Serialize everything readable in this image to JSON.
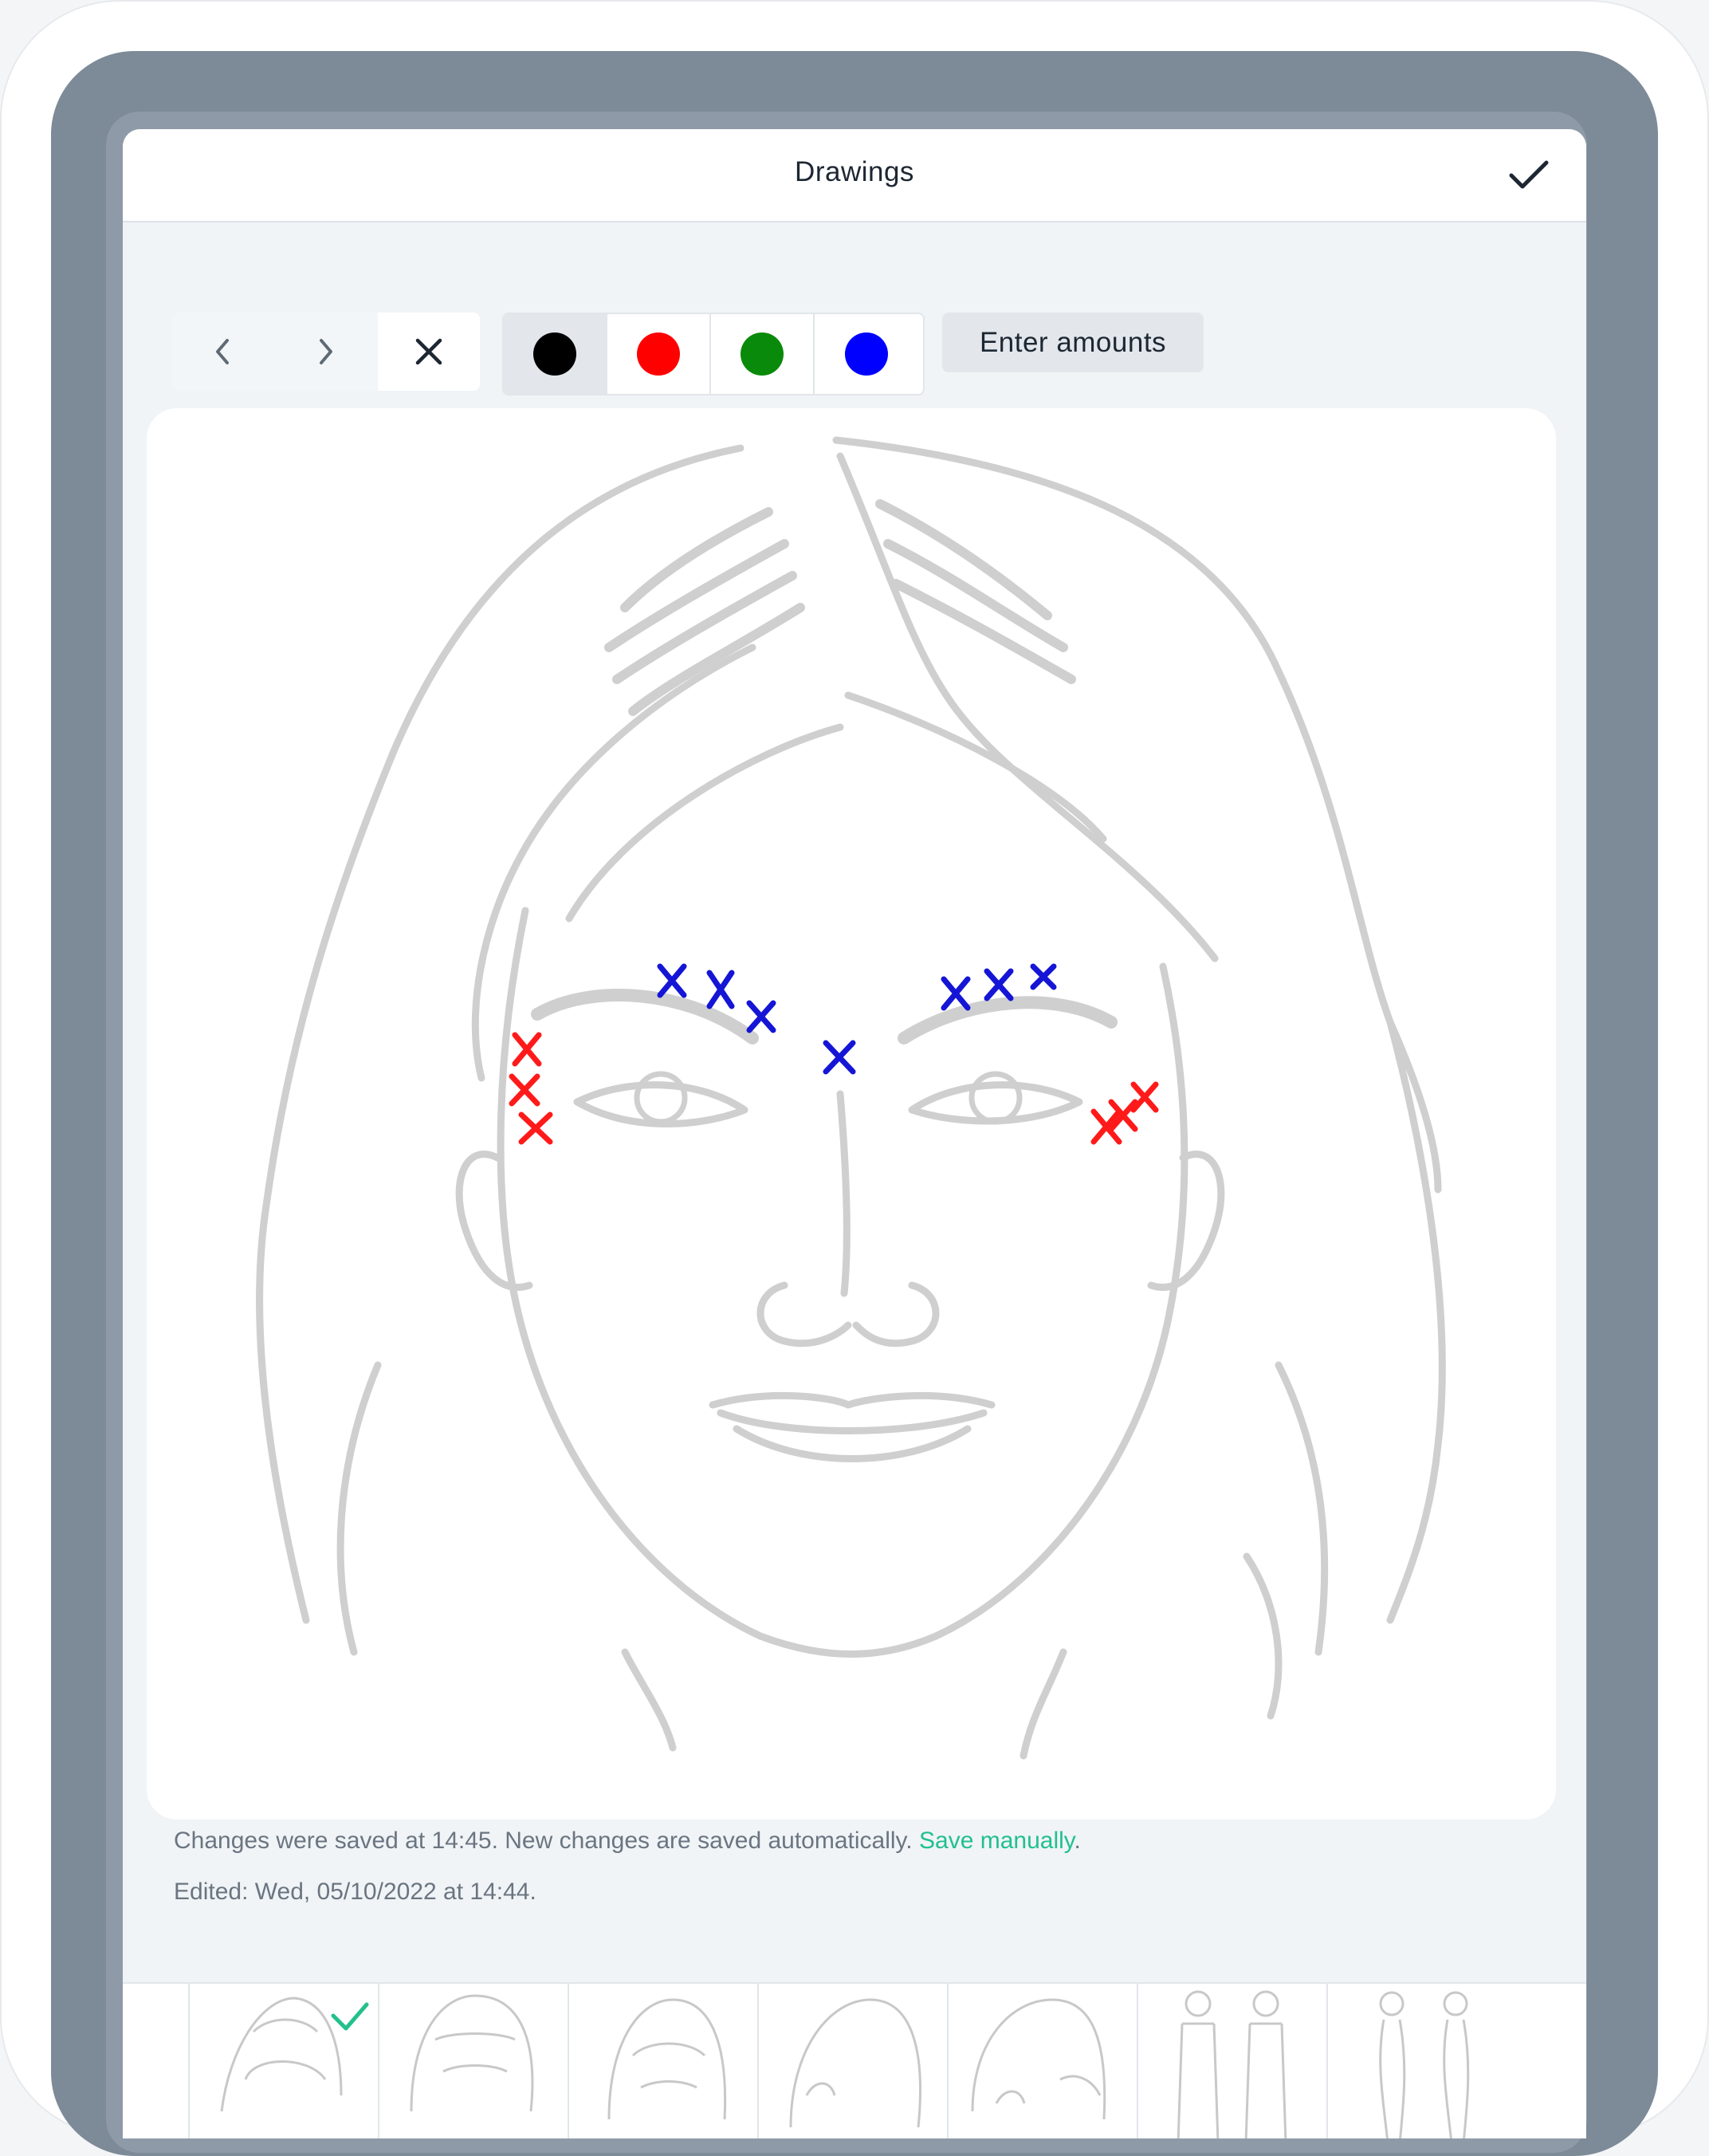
{
  "header": {
    "title": "Drawings"
  },
  "toolbar": {
    "nav": [
      "previous-icon",
      "next-icon",
      "clear-icon"
    ],
    "colors": [
      {
        "name": "black",
        "hex": "#000000",
        "selected": true
      },
      {
        "name": "red",
        "hex": "#ff0000",
        "selected": false
      },
      {
        "name": "green",
        "hex": "#0a8a0a",
        "selected": false
      },
      {
        "name": "blue",
        "hex": "#0000ff",
        "selected": false
      }
    ],
    "enter_amounts_label": "Enter amounts"
  },
  "status": {
    "saved_text": "Changes were saved at 14:45. New changes are saved automatically.",
    "save_link": "Save manually",
    "trailing": ".",
    "edited_text": "Edited: Wed, 05/10/2022 at 14:44."
  },
  "accent": "#22c08c",
  "thumbnails": [
    {
      "icon": "face-front-thumbnail",
      "checked": true
    },
    {
      "icon": "head-front-thumbnail",
      "checked": false
    },
    {
      "icon": "face-frown-thumbnail",
      "checked": false
    },
    {
      "icon": "head-side-thumbnail",
      "checked": false
    },
    {
      "icon": "head-back-thumbnail",
      "checked": false
    },
    {
      "icon": "body-front-back-thumbnail",
      "checked": false
    },
    {
      "icon": "body-side-thumbnail",
      "checked": false
    }
  ]
}
